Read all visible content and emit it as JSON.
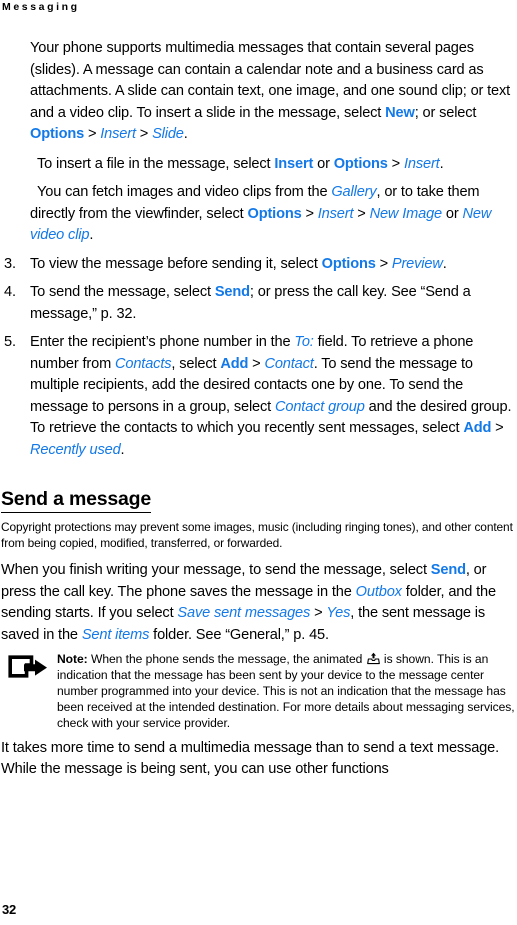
{
  "header": {
    "running_title": "Messaging"
  },
  "intro": {
    "p1_a": "Your phone supports multimedia messages that contain several pages (slides). A message can contain a calendar note and a business card as attachments. A slide can contain text, one image, and one sound clip; or text and a video clip. To insert a slide in the message, select ",
    "p1_new": "New",
    "p1_b": "; or select ",
    "p1_options": "Options",
    "p1_gt1": " > ",
    "p1_insert": "Insert",
    "p1_gt2": " > ",
    "p1_slide": "Slide",
    "p1_c": ".",
    "p2_a": "To insert a file in the message, select ",
    "p2_insert_bold": "Insert",
    "p2_b": " or ",
    "p2_options": "Options",
    "p2_gt": " > ",
    "p2_insert_italic": "Insert",
    "p2_c": ".",
    "p3_a": "You can fetch images and video clips from the ",
    "p3_gallery": "Gallery",
    "p3_b": ", or  to take them directly from the viewfinder, select ",
    "p3_options": "Options",
    "p3_gt1": " > ",
    "p3_insert": "Insert",
    "p3_gt2": " > ",
    "p3_newimage": "New Image",
    "p3_c": " or ",
    "p3_newvideo": "New video clip",
    "p3_d": "."
  },
  "steps": [
    {
      "num": "3.",
      "parts": [
        {
          "t": "To view the message before sending it, select ",
          "s": "plain"
        },
        {
          "t": "Options",
          "s": "ui"
        },
        {
          "t": " > ",
          "s": "sep"
        },
        {
          "t": "Preview",
          "s": "menu"
        },
        {
          "t": ".",
          "s": "plain"
        }
      ]
    },
    {
      "num": "4.",
      "parts": [
        {
          "t": "To send the message, select ",
          "s": "plain"
        },
        {
          "t": "Send",
          "s": "ui"
        },
        {
          "t": "; or press the call key. See “Send a message,” p. 32.",
          "s": "plain"
        }
      ]
    },
    {
      "num": "5.",
      "parts": [
        {
          "t": "Enter the recipient’s phone number in the ",
          "s": "plain"
        },
        {
          "t": "To:",
          "s": "menu"
        },
        {
          "t": " field. To retrieve a phone number from ",
          "s": "plain"
        },
        {
          "t": "Contacts",
          "s": "menu"
        },
        {
          "t": ", select ",
          "s": "plain"
        },
        {
          "t": "Add",
          "s": "ui"
        },
        {
          "t": " > ",
          "s": "sep"
        },
        {
          "t": "Contact",
          "s": "menu"
        },
        {
          "t": ". To send the message to multiple recipients, add the desired contacts one by one. To send the message to persons in a group, select ",
          "s": "plain"
        },
        {
          "t": "Contact group",
          "s": "menu"
        },
        {
          "t": " and the desired group. To retrieve the contacts to which you recently sent messages, select ",
          "s": "plain"
        },
        {
          "t": "Add",
          "s": "ui"
        },
        {
          "t": " > ",
          "s": "sep"
        },
        {
          "t": "Recently used",
          "s": "menu"
        },
        {
          "t": ".",
          "s": "plain"
        }
      ]
    }
  ],
  "section": {
    "heading": "Send a message",
    "copyright": "Copyright protections may prevent some images, music (including ringing tones), and other content from being copied, modified, transferred, or forwarded.",
    "p_a": "When you finish writing your message, to send the message, select ",
    "p_send": "Send",
    "p_b": ", or press the call key. The phone saves the message in the ",
    "p_outbox": "Outbox",
    "p_c": " folder, and the sending starts. If you select ",
    "p_savesent": "Save sent messages",
    "p_gt": " > ",
    "p_yes": "Yes",
    "p_d": ", the sent message is saved in the ",
    "p_sentitems": "Sent items",
    "p_e": " folder. See “General,” p. 45."
  },
  "note": {
    "label": "Note:",
    "text_a": " When the phone sends the message, the animated ",
    "text_b": " is shown. This is an indication that the message has been sent by your device to the message center number programmed into your device. This is not an indication that the message has been received at the intended destination. For more details about messaging services, check with your service provider.",
    "icon_name": "note-arrow-icon",
    "inline_icon_name": "message-sending-icon"
  },
  "closing": {
    "text": "It takes more time to send a multimedia message than to send a text message. While the message is being sent, you can use other functions"
  },
  "folio": {
    "page_number": "32"
  },
  "colors": {
    "ui_blue": "#1379E8",
    "text_black": "#000000",
    "page_background": "#FFFFFF"
  }
}
